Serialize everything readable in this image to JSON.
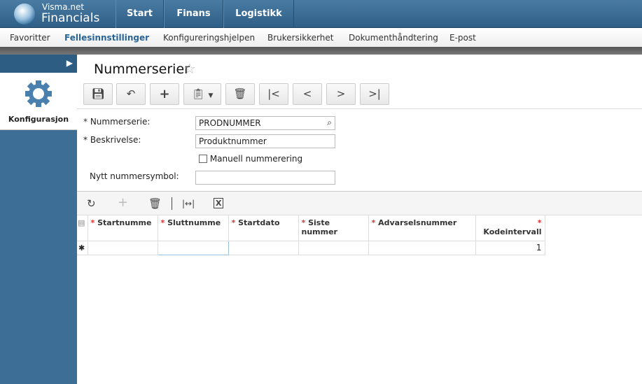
{
  "header": {
    "brand_top": "Visma.net",
    "brand_bottom": "Financials",
    "tabs": [
      "Start",
      "Finans",
      "Logistikk"
    ]
  },
  "nav": [
    "Favoritter",
    "Fellesinnstillinger",
    "Konfigureringshjelpen",
    "Brukersikkerhet",
    "Dokumenthåndtering",
    "E-post"
  ],
  "sidebar": {
    "module": "Konfigurasjon"
  },
  "page": {
    "title": "Nummerserier"
  },
  "form": {
    "nummerserie_label": "Nummerserie:",
    "nummerserie_value": "PRODNUMMER",
    "beskrivelse_label": "Beskrivelse:",
    "beskrivelse_value": "Produktnummer",
    "manuell_label": "Manuell nummerering",
    "manuell_checked": false,
    "symbol_label": "Nytt nummersymbol:",
    "symbol_value": ""
  },
  "grid": {
    "columns": [
      "Startnumme",
      "Sluttnumme",
      "Startdato",
      "Siste nummer",
      "Advarselsnummer",
      "Kodeintervall"
    ],
    "rows": [
      [
        "",
        "",
        "",
        "",
        "",
        "1"
      ]
    ]
  },
  "colors": {
    "header": "#3a6b93",
    "sidebar": "#3c6e96",
    "accent": "#2a6496"
  }
}
